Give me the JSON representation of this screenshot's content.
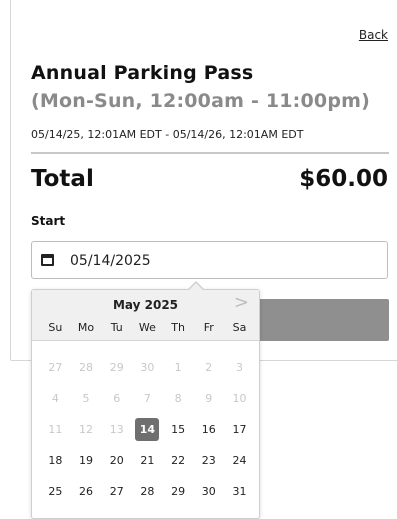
{
  "header": {
    "back_link": "Back"
  },
  "product": {
    "title": "Annual Parking Pass",
    "subtitle": "(Mon-Sun, 12:00am - 11:00pm)",
    "validity": "05/14/25, 12:01AM EDT - 05/14/26, 12:01AM EDT"
  },
  "summary": {
    "total_label": "Total",
    "total_value": "$60.00"
  },
  "start": {
    "label": "Start",
    "value": "05/14/2025",
    "icon": "calendar-icon"
  },
  "calendar": {
    "month_label": "May 2025",
    "next_icon": ">",
    "weekdays": [
      "Su",
      "Mo",
      "Tu",
      "We",
      "Th",
      "Fr",
      "Sa"
    ],
    "weeks": [
      [
        "27",
        "28",
        "29",
        "30",
        "1",
        "2",
        "3"
      ],
      [
        "4",
        "5",
        "6",
        "7",
        "8",
        "9",
        "10"
      ],
      [
        "11",
        "12",
        "13",
        "14",
        "15",
        "16",
        "17"
      ],
      [
        "18",
        "19",
        "20",
        "21",
        "22",
        "23",
        "24"
      ],
      [
        "25",
        "26",
        "27",
        "28",
        "29",
        "30",
        "31"
      ]
    ],
    "selected_day": "14"
  }
}
